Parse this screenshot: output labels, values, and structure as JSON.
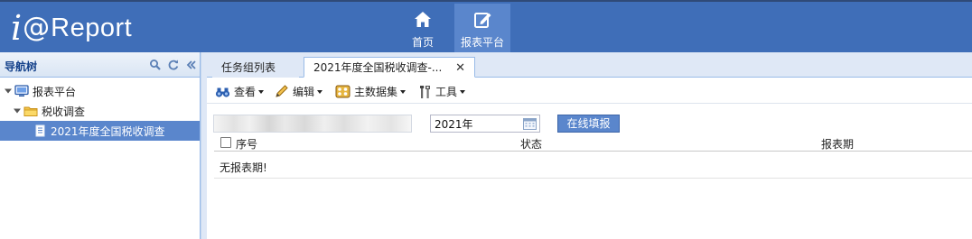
{
  "header": {
    "logo": {
      "i": "i",
      "at": "@",
      "rest": "Report"
    },
    "nav": [
      {
        "label": "首页",
        "icon": "home-icon"
      },
      {
        "label": "报表平台",
        "icon": "edit-report-icon",
        "active": true
      }
    ],
    "colors": {
      "bar": "#3f6eb8",
      "active": "#5a86cc"
    }
  },
  "sidebar": {
    "title": "导航树",
    "tools": [
      "search-icon",
      "refresh-icon",
      "collapse-icon"
    ],
    "tree": [
      {
        "label": "报表平台",
        "icon": "monitor-icon",
        "level": 0
      },
      {
        "label": "税收调查",
        "icon": "folder-icon",
        "level": 1
      },
      {
        "label": "2021年度全国税收调查",
        "icon": "document-icon",
        "level": 2,
        "selected": true
      }
    ]
  },
  "tabs": [
    {
      "label": "任务组列表"
    },
    {
      "label": "2021年度全国税收调查-...",
      "active": true,
      "close": "✕"
    }
  ],
  "toolbar": {
    "view": "查看",
    "edit": "编辑",
    "master_data": "主数据集",
    "tools": "工具"
  },
  "form": {
    "year_value": "2021年",
    "fill_online": "在线填报"
  },
  "grid": {
    "columns": [
      "序号",
      "状态",
      "报表期"
    ],
    "empty_message": "无报表期!"
  }
}
